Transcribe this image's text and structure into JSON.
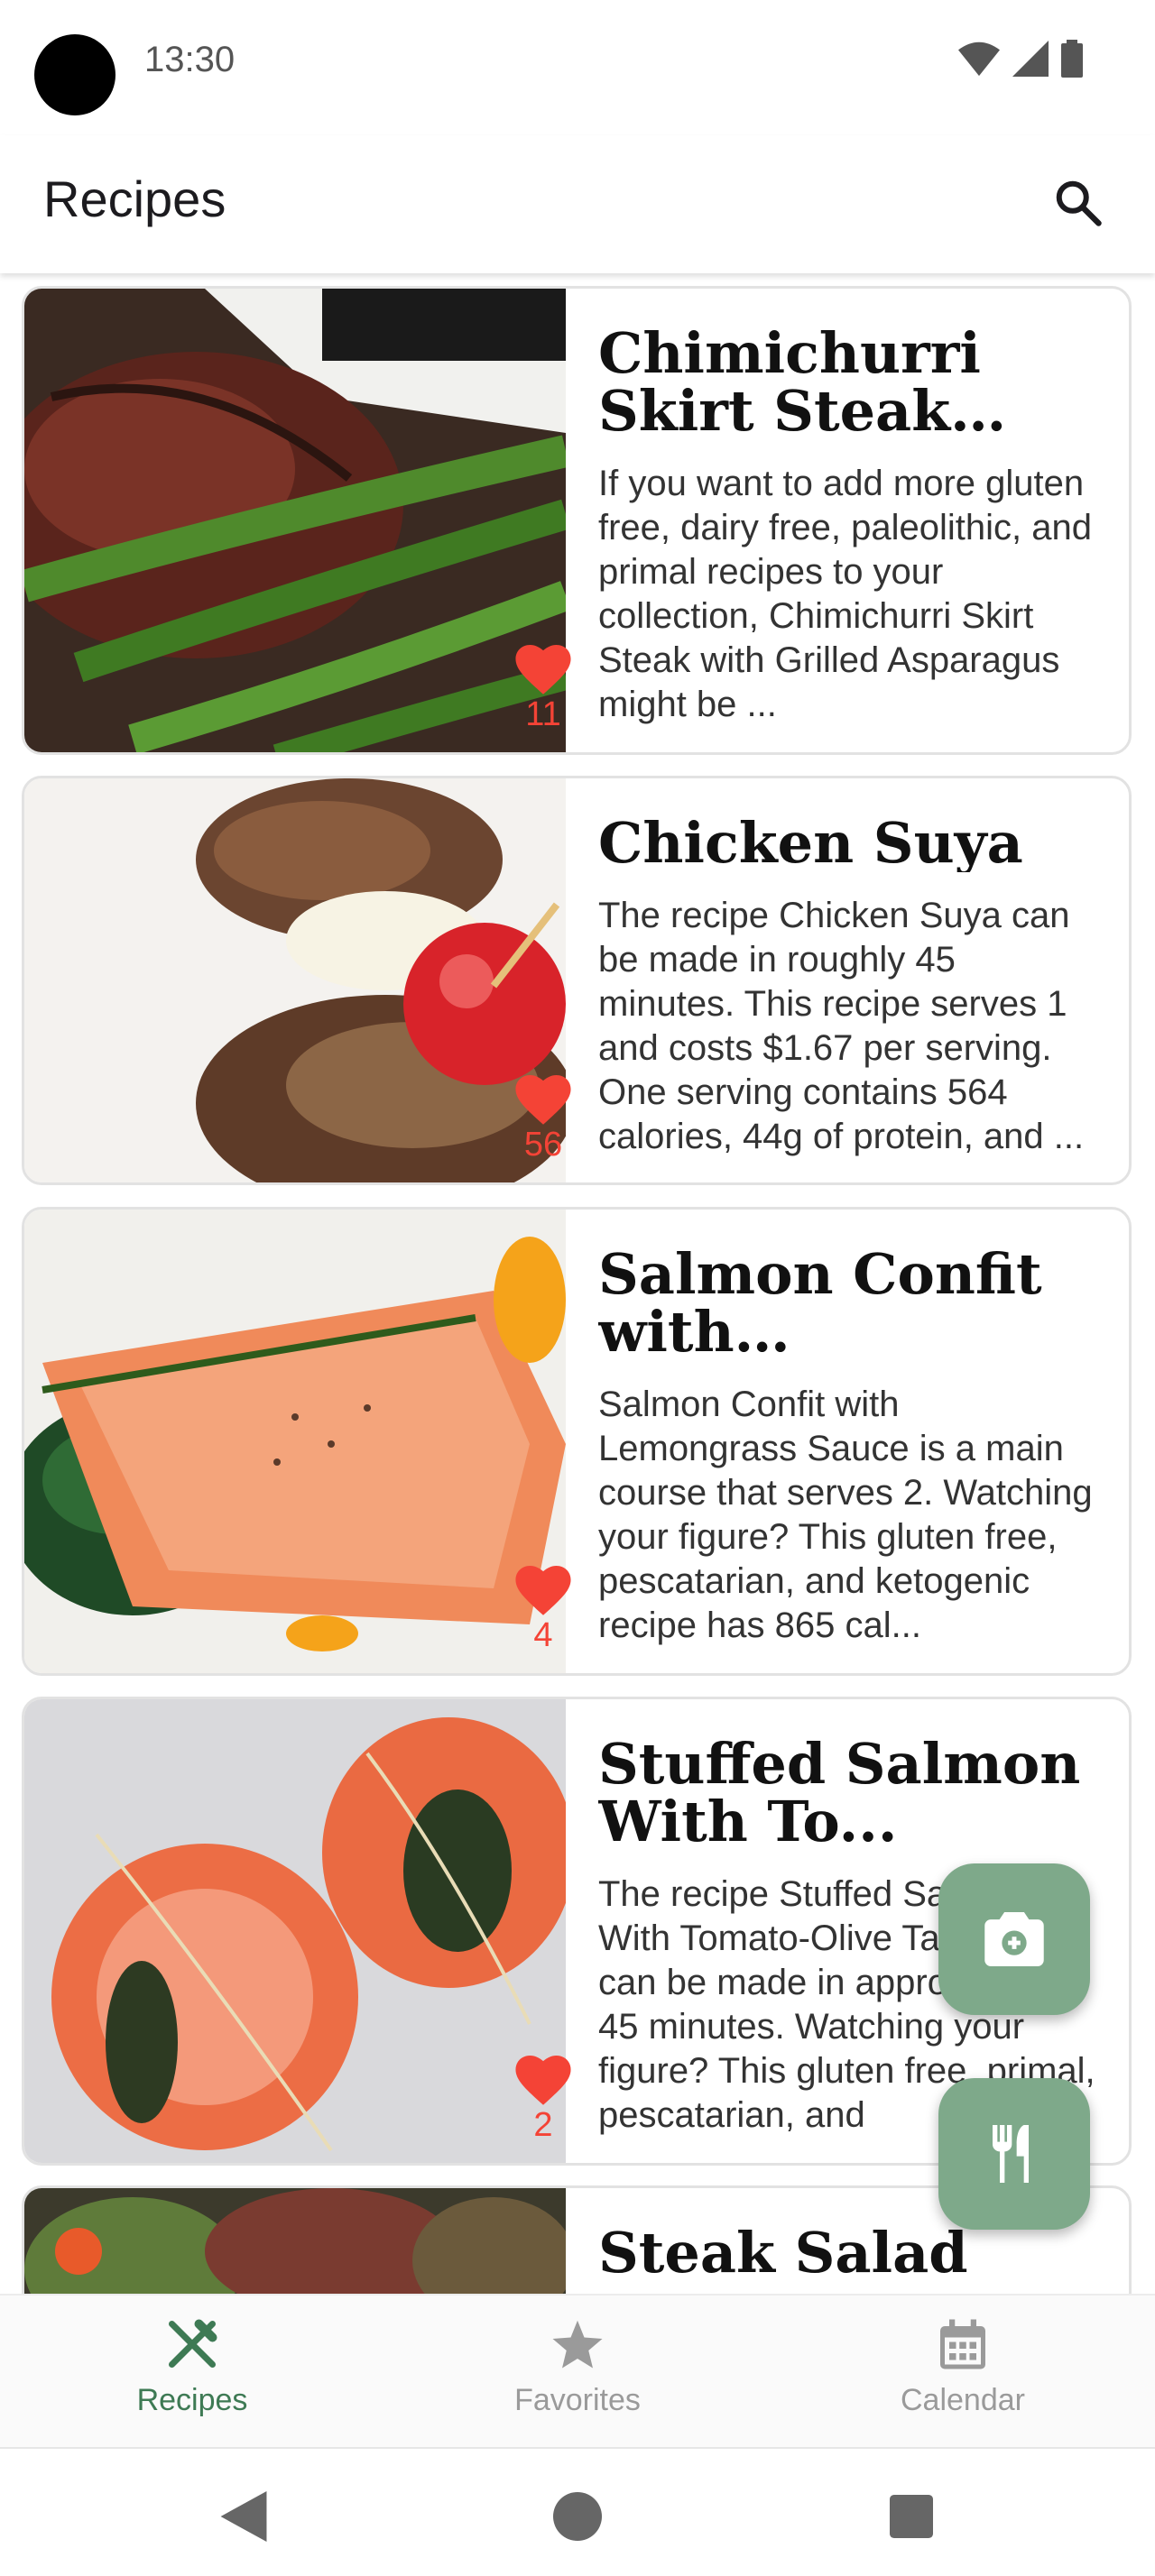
{
  "status_bar": {
    "time": "13:30",
    "icons": [
      "wifi-icon",
      "signal-icon",
      "battery-icon"
    ]
  },
  "app_bar": {
    "title": "Recipes",
    "search_icon": "search-icon"
  },
  "recipes": [
    {
      "title": "Chimichurri Skirt Steak wit...",
      "description": "If you want to add more gluten free, dairy free, paleolithic, and primal recipes to your collection, Chimichurri Skirt Steak with Grilled Asparagus might be ...",
      "likes": "11"
    },
    {
      "title": "Chicken Suya",
      "description": "The recipe Chicken Suya can be made in roughly 45 minutes. This recipe serves 1 and costs $1.67 per serving. One serving contains 564 calories, 44g of protein, and ...",
      "likes": "56"
    },
    {
      "title": "Salmon Confit with Lemongra...",
      "description": "Salmon Confit with Lemongrass Sauce is a main course that serves 2. Watching your figure? This gluten free, pescatarian, and ketogenic recipe has 865 cal...",
      "likes": "4"
    },
    {
      "title": "Stuffed Salmon With To...",
      "description": "The recipe Stuffed Salmon With Tomato-Olive Tapenade can be made in approximately 45 minutes. Watching your figure? This gluten free, primal, pescatarian, and",
      "likes": "2"
    },
    {
      "title": "Steak Salad",
      "description": "",
      "likes": ""
    }
  ],
  "fabs": {
    "camera_icon": "camera-add-icon",
    "utensils_icon": "restaurant-icon"
  },
  "bottom_nav": {
    "items": [
      {
        "label": "Recipes",
        "icon": "fork-knife-icon",
        "active": true
      },
      {
        "label": "Favorites",
        "icon": "star-icon",
        "active": false
      },
      {
        "label": "Calendar",
        "icon": "calendar-icon",
        "active": false
      }
    ]
  },
  "system_nav": {
    "icons": [
      "back-icon",
      "home-icon",
      "recents-icon"
    ]
  },
  "colors": {
    "accent": "#3e7a54",
    "fab": "#7ea98a",
    "like": "#f44336"
  }
}
